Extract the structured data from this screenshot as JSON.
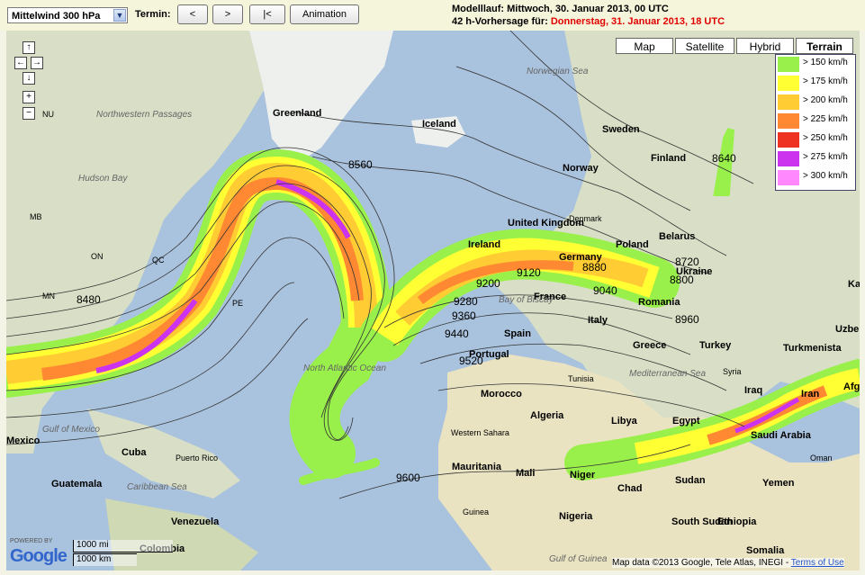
{
  "toolbar": {
    "level_select": "Mittelwind 300 hPa",
    "termin_label": "Termin:",
    "prev_label": "<",
    "next_label": ">",
    "first_label": "|<",
    "animation_label": "Animation"
  },
  "info": {
    "modelllauf": "Modelllauf: Mittwoch, 30. Januar 2013, 00 UTC",
    "forecast_prefix": "42 h-Vorhersage für: ",
    "forecast_date": "Donnerstag, 31. Januar 2013, 18 UTC"
  },
  "map_types": [
    "Map",
    "Satellite",
    "Hybrid",
    "Terrain"
  ],
  "active_map_type": "Terrain",
  "nav_controls": [
    "pan-up-icon",
    "pan-left-icon",
    "pan-right-icon",
    "pan-down-icon",
    "zoom-in-icon",
    "zoom-out-icon"
  ],
  "legend": [
    {
      "label": "> 150 km/h",
      "color": "#99f04a"
    },
    {
      "label": "> 175 km/h",
      "color": "#ffff33"
    },
    {
      "label": "> 200 km/h",
      "color": "#ffcc33"
    },
    {
      "label": "> 225 km/h",
      "color": "#ff8833"
    },
    {
      "label": "> 250 km/h",
      "color": "#ee3322"
    },
    {
      "label": "> 275 km/h",
      "color": "#cc33ee"
    },
    {
      "label": "> 300 km/h",
      "color": "#ff88ff"
    }
  ],
  "places": [
    "Greenland",
    "Iceland",
    "Sweden",
    "Finland",
    "Norway",
    "Denmark",
    "Belarus",
    "Poland",
    "United Kingdom",
    "Ireland",
    "Germany",
    "Ukraine",
    "France",
    "Romania",
    "Italy",
    "Spain",
    "Portugal",
    "Greece",
    "Turkey",
    "Turkmenista",
    "Uzbek",
    "Syria",
    "Iraq",
    "Iran",
    "Afg",
    "Morocco",
    "Algeria",
    "Libya",
    "Egypt",
    "Tunisia",
    "Western Sahara",
    "Mauritania",
    "Mali",
    "Niger",
    "Chad",
    "Sudan",
    "Yemen",
    "Oman",
    "Saudi Arabia",
    "Nigeria",
    "Ethiopia",
    "South Sudan",
    "Somalia",
    "Guinea",
    "Cuba",
    "Puerto Rico",
    "Guatemala",
    "Venezuela",
    "Colombia",
    "Mexico",
    "Hudson Bay",
    "Northwestern Passages",
    "NU",
    "MB",
    "QC",
    "ON",
    "MN",
    "PE",
    "North Atlantic Ocean",
    "Norwegian Sea",
    "Bay of Biscay",
    "Gulf of Mexico",
    "Caribbean Sea",
    "Mediterranean Sea",
    "Gulf of Guinea",
    "Kaz"
  ],
  "isohypses": [
    "8480",
    "8560",
    "8640",
    "8720",
    "8800",
    "8880",
    "8960",
    "9040",
    "9120",
    "9200",
    "9280",
    "9360",
    "9440",
    "9520",
    "9600"
  ],
  "scale": {
    "miles": "1000 mi",
    "km": "1000 km"
  },
  "logo": {
    "powered": "POWERED BY",
    "name": "Google"
  },
  "copyright": {
    "text": "Map data ©2013 Google, Tele Atlas, INEGI - ",
    "link": "Terms of Use"
  }
}
